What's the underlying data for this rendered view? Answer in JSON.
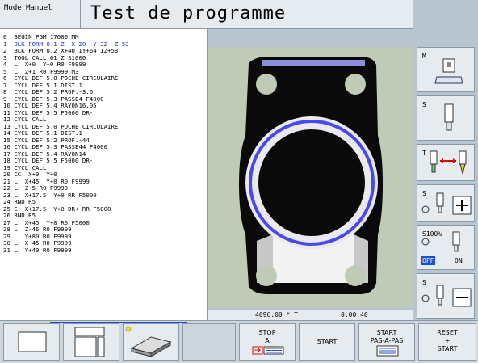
{
  "header": {
    "mode": "Mode Manuel",
    "title": "Test de programme"
  },
  "program": {
    "lines": [
      "0  BEGIN PGM 17000 MM",
      "1  BLK FORM 0.1 Z  X-20  Y-32  Z-53",
      "2  BLK FORM 0.2 X+40 IY+64 IZ+53",
      "3  TOOL CALL 61 Z S1000",
      "4  L  X+0  Y+0 R0 F9999",
      "5  L  Z+1 R0 F9999 M3",
      "6  CYCL DEF 5.0 POCHE CIRCULAIRE",
      "7  CYCL DEF 5.1 DIST.1",
      "8  CYCL DEF 5.2 PROF.-3.6",
      "9  CYCL DEF 5.3 PASSE4 F4000",
      "10 CYCL DEF 5.4 RAYON16.05",
      "11 CYCL DEF 5.5 F5000 DR-",
      "12 CYCL CALL",
      "13 CYCL DEF 5.0 POCHE CIRCULAIRE",
      "14 CYCL DEF 5.1 DIST.1",
      "15 CYCL DEF 5.2 PROF.-44",
      "16 CYCL DEF 5.3 PASSE44 F4000",
      "17 CYCL DEF 5.4 RAYON14",
      "18 CYCL DEF 5.5 F5000 DR-",
      "19 CYCL CALL",
      "20 CC  X+0  Y+0",
      "21 L  X+45  Y+0 R0 F9999",
      "22 L  Z-5 R0 F9999",
      "23 L  X+17.5  Y+0 RR F5000",
      "24 RND R5",
      "25 C  X+17.5  Y+0 DR+ RR F5000",
      "26 RND R5",
      "27 L  X+45  Y+0 R0 F5000",
      "28 L  Z-46 R0 F9999",
      "29 L  Y+80 R0 F9999",
      "30 L  X-45 R0 F9999",
      "31 L  Y+40 R0 F9999"
    ],
    "highlight_index": 1
  },
  "status": {
    "coord": "4096.00 * T",
    "time": "0:00:40"
  },
  "right_keys": {
    "m_letter": "M",
    "s_letter": "S",
    "t_letter": "T",
    "s_plus_letter": "S",
    "feed_percent": "S100%",
    "off_label": "OFF",
    "on_label": "ON",
    "s_minus_letter": "S"
  },
  "bottom_keys": {
    "stop_line1": "STOP",
    "stop_line2": "A",
    "start": "START",
    "start_pas_line1": "START",
    "start_pas_line2": "PAS-A-PAS",
    "reset_line1": "RESET",
    "reset_line2": "+",
    "reset_line3": "START"
  },
  "colors": {
    "highlight_text": "#1a2fd6",
    "graphic_bg": "#bfcbb7",
    "part": "#0a0a0a",
    "path": "#4848ee",
    "active_toggle": "#2050d0"
  }
}
